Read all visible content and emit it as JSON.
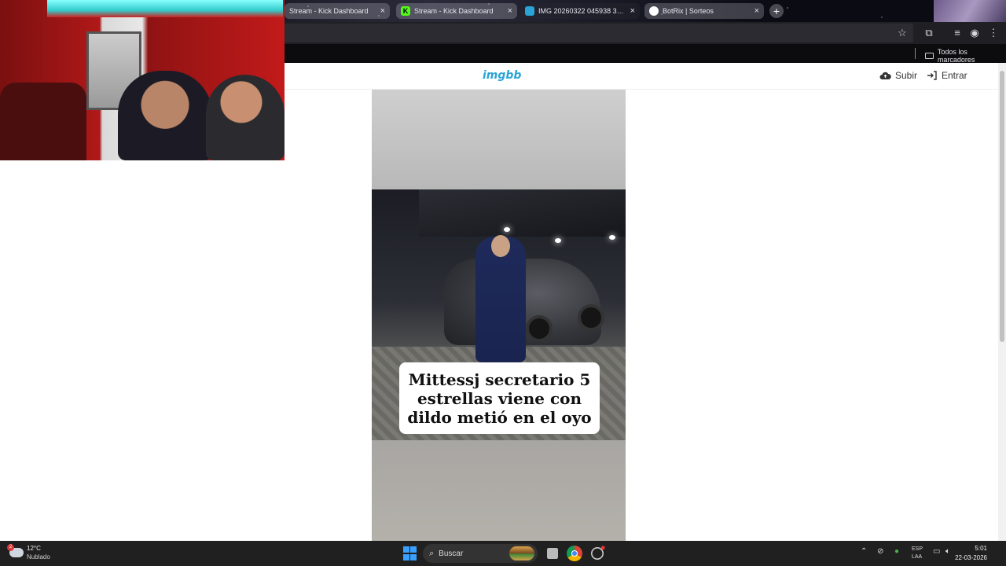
{
  "browser": {
    "tabs": [
      {
        "label": "Stream - Kick Dashboard",
        "favicon": "none"
      },
      {
        "label": "Stream - Kick Dashboard",
        "favicon": "kick-icon",
        "color": "#53fc18"
      },
      {
        "label": "IMG 20260322 045938 322 h...",
        "favicon": "imgbb-icon",
        "color": "#2aa4d6"
      },
      {
        "label": "BotRix | Sorteos",
        "favicon": "botrix-icon",
        "color": "#ffffff"
      }
    ],
    "bookmarks_all_label": "Todos los marcadores"
  },
  "site": {
    "logo": "imgbb",
    "upload_label": "Subir",
    "login_label": "Entrar",
    "accent": "#2aa4d6"
  },
  "image": {
    "caption": "Mittessj secretario 5 estrellas viene con dildo metió en el oyo"
  },
  "taskbar": {
    "weather_temp": "12°C",
    "weather_desc": "Nublado",
    "weather_badge": "2",
    "search_placeholder": "Buscar",
    "lang_top": "ESP",
    "lang_bottom": "LAA",
    "time": "5:01",
    "date": "22-03-2026"
  }
}
